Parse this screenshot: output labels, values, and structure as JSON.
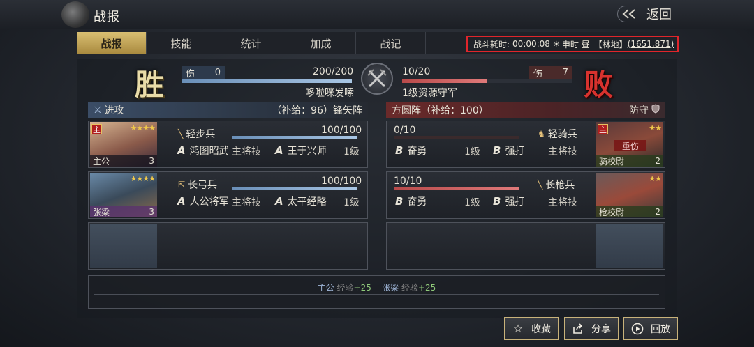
{
  "header": {
    "title": "战报",
    "back_label": "返回"
  },
  "tabs": [
    {
      "label": "战报",
      "active": true
    },
    {
      "label": "技能",
      "active": false
    },
    {
      "label": "统计",
      "active": false
    },
    {
      "label": "加成",
      "active": false
    },
    {
      "label": "战记",
      "active": false
    }
  ],
  "battle_info": {
    "duration_label": "战斗耗时:",
    "duration": "00:00:08",
    "time_of_day": "申时 昼",
    "terrain": "【林地】",
    "coords": "(1651,871)"
  },
  "result": {
    "attacker_result": "胜",
    "defender_result": "败"
  },
  "attacker_summary": {
    "wound_label": "伤",
    "wounded": "0",
    "troops": "200/200",
    "troops_fraction": 1.0,
    "name": "哆啦咪发嗦"
  },
  "defender_summary": {
    "wound_label": "伤",
    "wounded": "7",
    "troops": "10/20",
    "troops_fraction": 0.5,
    "name": "1级资源守军"
  },
  "attacker_header": {
    "icon": "sword-icon",
    "label": "进攻",
    "supply": "（补给：96）锋矢阵"
  },
  "defender_header": {
    "formation": "方圆阵（补给：100）",
    "label": "防守",
    "icon": "shield-icon"
  },
  "attacker_units": [
    {
      "general_tag": "主",
      "stars": "★★★★",
      "general_name": "主公",
      "level": "3",
      "troop_type": "轻步兵",
      "troops": "100/100",
      "troops_fraction": 1.0,
      "skill1_grade": "A",
      "skill1": "鸿图昭武",
      "skill1_role": "主将技",
      "skill2_grade": "A",
      "skill2": "王于兴师",
      "skill2_level": "1级"
    },
    {
      "general_tag": "",
      "stars": "★★★★",
      "general_name": "张梁",
      "level": "3",
      "troop_type": "长弓兵",
      "troops": "100/100",
      "troops_fraction": 1.0,
      "skill1_grade": "A",
      "skill1": "人公将军",
      "skill1_role": "主将技",
      "skill2_grade": "A",
      "skill2": "太平经略",
      "skill2_level": "1级"
    }
  ],
  "defender_units": [
    {
      "general_tag": "主",
      "stars": "★★",
      "general_name": "骑校尉",
      "level": "2",
      "troop_type": "轻骑兵",
      "troops": "0/10",
      "troops_fraction": 0.0,
      "status": "重伤",
      "skill1_grade": "B",
      "skill1": "奋勇",
      "skill1_level": "1级",
      "skill2_grade": "B",
      "skill2": "强打",
      "skill2_role": "主将技"
    },
    {
      "general_tag": "",
      "stars": "★★",
      "general_name": "枪校尉",
      "level": "2",
      "troop_type": "长枪兵",
      "troops": "10/10",
      "troops_fraction": 1.0,
      "status": "",
      "skill1_grade": "B",
      "skill1": "奋勇",
      "skill1_level": "1级",
      "skill2_grade": "B",
      "skill2": "强打",
      "skill2_role": "主将技"
    }
  ],
  "experience": [
    {
      "name": "主公",
      "label": "经验",
      "points": "+25"
    },
    {
      "name": "张梁",
      "label": "经验",
      "points": "+25"
    }
  ],
  "actions": {
    "favorite": "收藏",
    "share": "分享",
    "replay": "回放"
  },
  "colors": {
    "accent_gold": "#d9bf72",
    "highlight_box": "#e0252b",
    "win": "#e9dca8",
    "lose": "#d8322e"
  }
}
